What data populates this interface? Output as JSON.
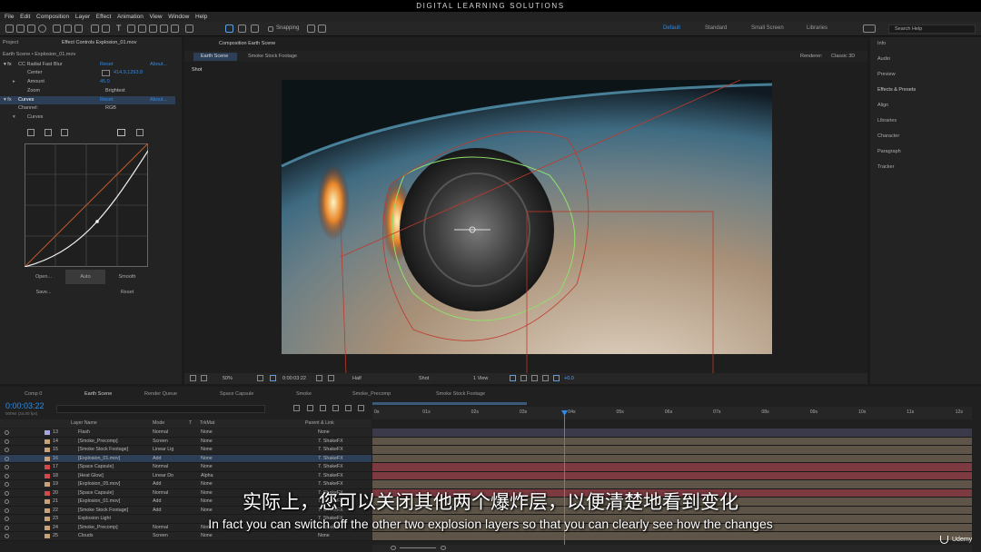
{
  "banner": "DIGITAL LEARNING SOLUTIONS",
  "menu": [
    "File",
    "Edit",
    "Composition",
    "Layer",
    "Effect",
    "Animation",
    "View",
    "Window",
    "Help"
  ],
  "toolbar": {
    "snapping": "Snapping",
    "workspaces": [
      "Default",
      "Standard",
      "Small Screen",
      "Libraries"
    ],
    "search_placeholder": "Search Help"
  },
  "left_panel": {
    "tabs": [
      "Project",
      "Effect Controls Explosion_01.mov"
    ],
    "layer_path": "Earth Scene • Explosion_01.mov",
    "effect1": {
      "name": "CC Radial Fast Blur",
      "reset": "Reset",
      "about": "About..."
    },
    "center": {
      "label": "Center",
      "value": "414.9,1293.8"
    },
    "amount": {
      "label": "Amount",
      "value": "45.0"
    },
    "zoom": {
      "label": "Zoom",
      "value": "Brightest"
    },
    "effect2": {
      "name": "Curves",
      "reset": "Reset",
      "about": "About..."
    },
    "channel": {
      "label": "Channel:",
      "value": "RGB"
    },
    "curves_label": "Curves",
    "buttons": [
      "Open...",
      "Auto",
      "Smooth",
      "Save...",
      "Reset"
    ]
  },
  "composition": {
    "tab": "Composition Earth Scene",
    "subtabs": [
      "Earth Scene",
      "Smoke Stock Footage"
    ],
    "renderer_label": "Renderer:",
    "renderer_value": "Classic 3D",
    "shot_label": "Shot",
    "footer": {
      "zoom": "50%",
      "timecode": "0:00:03:22",
      "resolution": "Half",
      "camera": "Shot",
      "views": "1 View",
      "exposure": "+0.0"
    }
  },
  "right_panel": {
    "items": [
      "Info",
      "Audio",
      "Preview",
      "Effects & Presets",
      "Align",
      "Libraries",
      "Character",
      "Paragraph",
      "Tracker"
    ]
  },
  "timeline": {
    "tabs": [
      "Comp 0",
      "Earth Scene",
      "Render Queue",
      "Space Capsule",
      "Smoke",
      "Smoke_Precomp",
      "Smoke Stock Footage"
    ],
    "timecode": "0:00:03:22",
    "fps": "00094 (24.00 fps)",
    "col_headers": {
      "layer_name": "Layer Name",
      "mode": "Mode",
      "t": "T",
      "trkmat": "TrkMat",
      "parent": "Parent & Link"
    },
    "ticks": [
      "0s",
      "01s",
      "02s",
      "03s",
      "04s",
      "05s",
      "06s",
      "07s",
      "08s",
      "09s",
      "10s",
      "11s",
      "12s"
    ],
    "layers": [
      {
        "num": "13",
        "name": "Flash",
        "mode": "Normal",
        "trk": "None",
        "parent": "None",
        "color": "#a8a8e0"
      },
      {
        "num": "14",
        "name": "[Smoke_Precomp]",
        "mode": "Screen",
        "trk": "None",
        "parent": "7. ShakeFX",
        "color": "#c9a27a"
      },
      {
        "num": "15",
        "name": "[Smoke Stock Footage]",
        "mode": "Linear Lig",
        "trk": "None",
        "parent": "7. ShakeFX",
        "color": "#c9a27a"
      },
      {
        "num": "16",
        "name": "[Explosion_01.mov]",
        "mode": "Add",
        "trk": "None",
        "parent": "7. ShakeFX",
        "color": "#c9a27a"
      },
      {
        "num": "17",
        "name": "[Space Capsule]",
        "mode": "Normal",
        "trk": "None",
        "parent": "7. ShakeFX",
        "color": "#d04a4a"
      },
      {
        "num": "18",
        "name": "[Heat Glow]",
        "mode": "Linear Do",
        "trk": "Alpha",
        "parent": "7. ShakeFX",
        "color": "#d04a4a"
      },
      {
        "num": "19",
        "name": "[Explosion_05.mov]",
        "mode": "Add",
        "trk": "None",
        "parent": "7. ShakeFX",
        "color": "#c9a27a"
      },
      {
        "num": "20",
        "name": "[Space Capsule]",
        "mode": "Normal",
        "trk": "None",
        "parent": "7. ShakeFX",
        "color": "#d04a4a"
      },
      {
        "num": "21",
        "name": "[Explosion_01.mov]",
        "mode": "Add",
        "trk": "None",
        "parent": "7. ShakeFX",
        "color": "#c9a27a"
      },
      {
        "num": "22",
        "name": "[Smoke Stock Footage]",
        "mode": "Add",
        "trk": "None",
        "parent": "7. ShakeFX",
        "color": "#c9a27a"
      },
      {
        "num": "23",
        "name": "Explosion Light",
        "mode": "",
        "trk": "",
        "parent": "7. ShakeFX",
        "color": "#c9a27a"
      },
      {
        "num": "24",
        "name": "[Smoke_Precomp]",
        "mode": "Normal",
        "trk": "None",
        "parent": "7. ShakeFX",
        "color": "#c9a27a"
      },
      {
        "num": "25",
        "name": "Clouds",
        "mode": "Screen",
        "trk": "None",
        "parent": "None",
        "color": "#c9a27a"
      }
    ]
  },
  "subtitle_cn": "实际上，您可以关闭其他两个爆炸层，以便清楚地看到变化",
  "subtitle_en": "In fact you can switch off the other two explosion layers so that you can clearly see how the changes",
  "watermark": "Udemy"
}
